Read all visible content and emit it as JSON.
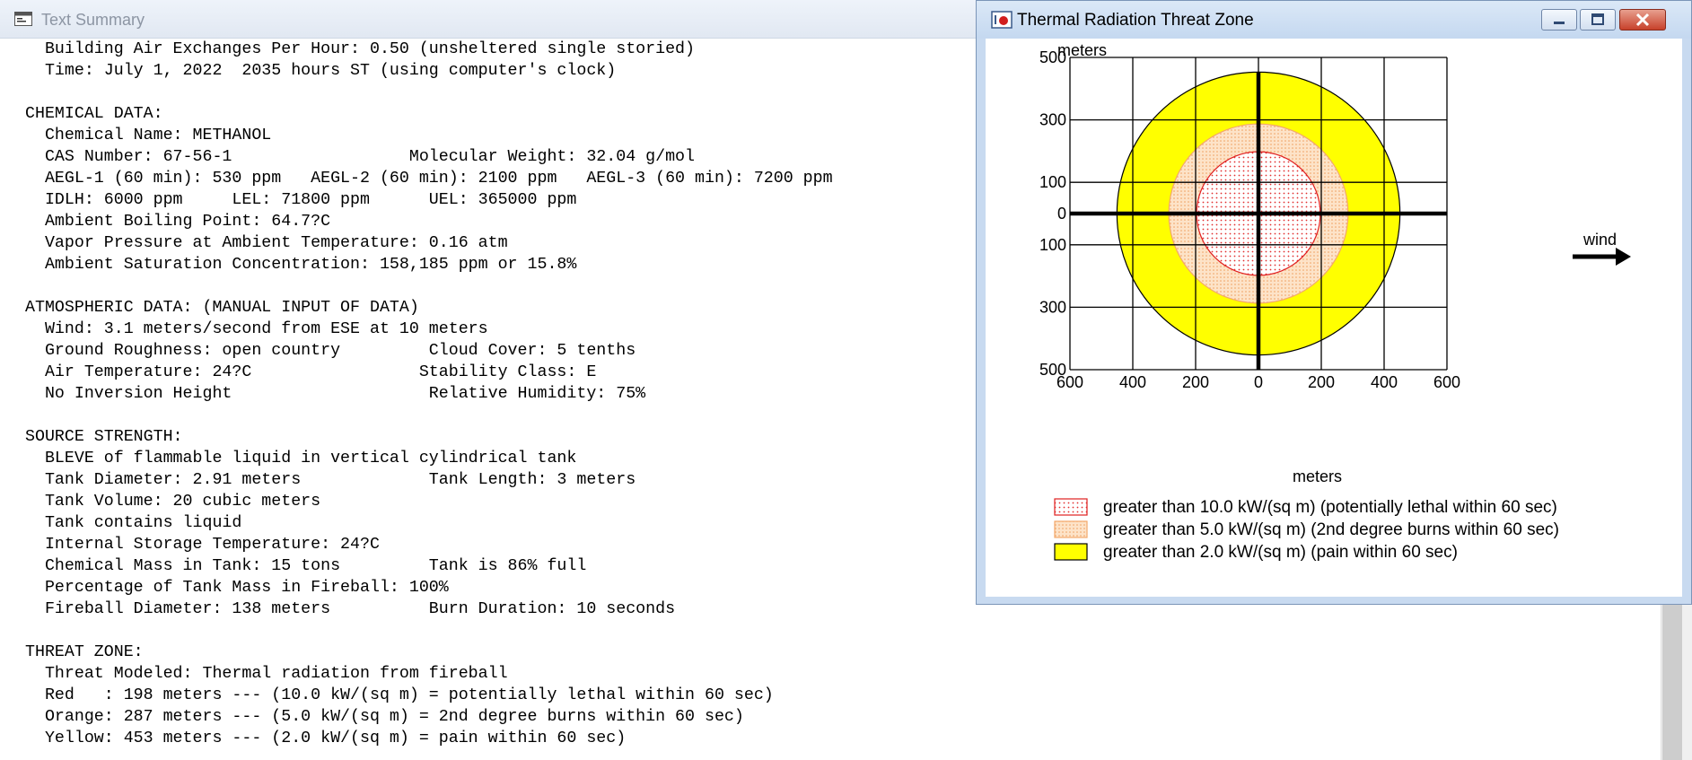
{
  "text_summary": {
    "title": "Text Summary",
    "lines": [
      "Building Air Exchanges Per Hour: 0.50 (unsheltered single storied)",
      "Time: July 1, 2022  2035 hours ST (using computer's clock)",
      "",
      "CHEMICAL DATA:",
      "Chemical Name: METHANOL",
      "CAS Number: 67-56-1                  Molecular Weight: 32.04 g/mol",
      "AEGL-1 (60 min): 530 ppm   AEGL-2 (60 min): 2100 ppm   AEGL-3 (60 min): 7200 ppm",
      "IDLH: 6000 ppm     LEL: 71800 ppm      UEL: 365000 ppm",
      "Ambient Boiling Point: 64.7?C",
      "Vapor Pressure at Ambient Temperature: 0.16 atm",
      "Ambient Saturation Concentration: 158,185 ppm or 15.8%",
      "",
      "ATMOSPHERIC DATA: (MANUAL INPUT OF DATA)",
      "Wind: 3.1 meters/second from ESE at 10 meters",
      "Ground Roughness: open country         Cloud Cover: 5 tenths",
      "Air Temperature: 24?C                 Stability Class: E",
      "No Inversion Height                    Relative Humidity: 75%",
      "",
      "SOURCE STRENGTH:",
      "BLEVE of flammable liquid in vertical cylindrical tank",
      "Tank Diameter: 2.91 meters             Tank Length: 3 meters",
      "Tank Volume: 20 cubic meters",
      "Tank contains liquid",
      "Internal Storage Temperature: 24?C",
      "Chemical Mass in Tank: 15 tons         Tank is 86% full",
      "Percentage of Tank Mass in Fireball: 100%",
      "Fireball Diameter: 138 meters          Burn Duration: 10 seconds",
      "",
      "THREAT ZONE:",
      "Threat Modeled: Thermal radiation from fireball",
      "Red   : 198 meters --- (10.0 kW/(sq m) = potentially lethal within 60 sec)",
      "Orange: 287 meters --- (5.0 kW/(sq m) = 2nd degree burns within 60 sec)",
      "Yellow: 453 meters --- (2.0 kW/(sq m) = pain within 60 sec)"
    ]
  },
  "threat_window": {
    "title": "Thermal Radiation Threat Zone",
    "y_unit_label": "meters",
    "x_unit_label": "meters",
    "wind_label": "wind",
    "y_ticks": [
      "500",
      "300",
      "100",
      "0",
      "100",
      "300",
      "500"
    ],
    "x_ticks": [
      "600",
      "400",
      "200",
      "0",
      "200",
      "400",
      "600"
    ],
    "legend": [
      {
        "label": "greater than 10.0 kW/(sq m) (potentially lethal within 60 sec)",
        "color": "#ffffff",
        "pattern": "red-dots"
      },
      {
        "label": "greater than 5.0 kW/(sq m) (2nd degree burns within 60 sec)",
        "color": "#fde2c8",
        "pattern": "orange-dots"
      },
      {
        "label": "greater than 2.0 kW/(sq m) (pain within 60 sec)",
        "color": "#ffff00",
        "pattern": "solid"
      }
    ],
    "zones": [
      {
        "name": "Yellow",
        "radius_m": 453,
        "color": "#ffff00"
      },
      {
        "name": "Orange",
        "radius_m": 287,
        "color": "#fde2c8"
      },
      {
        "name": "Red",
        "radius_m": 198,
        "color": "#ffffff"
      }
    ]
  }
}
